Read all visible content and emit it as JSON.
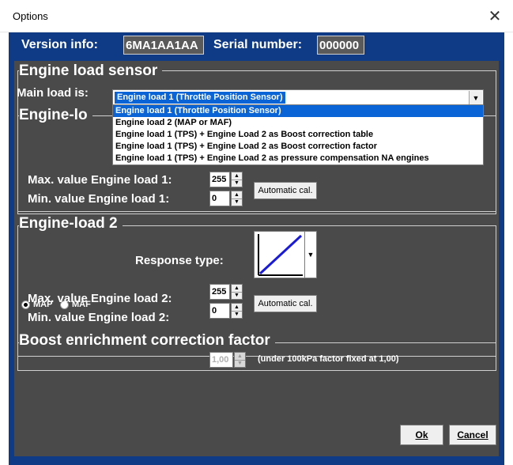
{
  "window": {
    "title": "Options",
    "close_glyph": "✕"
  },
  "version": {
    "label": "Version info:",
    "value": "6MA1AA1AA",
    "serial_label": "Serial number:",
    "serial_value": "000000"
  },
  "engine_load_sensor": {
    "title": "Engine load sensor",
    "main_load_label": "Main load is:",
    "selected": "Engine load 1 (Throttle Position Sensor)",
    "options": [
      "Engine load 1 (Throttle Position Sensor)",
      "Engine load 2 (MAP or MAF)",
      "Engine load 1 (TPS) + Engine Load 2 as Boost correction table",
      "Engine load 1 (TPS) + Engine Load 2 as Boost correction factor",
      "Engine load 1 (TPS) + Engine Load 2 as pressure compensation NA engines"
    ]
  },
  "engine_load_1": {
    "title_visible": "Engine-lo",
    "max_label": "Max. value Engine load 1:",
    "max_value": "255",
    "min_label": "Min.  value Engine load 1:",
    "min_value": "0",
    "auto_cal": "Automatic cal."
  },
  "engine_load_2": {
    "title": "Engine-load 2",
    "radio_map": "MAP",
    "radio_maf": "MAF",
    "selected_radio": "MAP",
    "response_label": "Response type:",
    "response_icon": "linear-response-icon",
    "max_label": "Max. value Engine load 2:",
    "max_value": "255",
    "min_label": "Min.  value Engine load 2:",
    "min_value": "0",
    "auto_cal": "Automatic cal."
  },
  "boost": {
    "title": "Boost enrichment correction factor",
    "value": "1,00",
    "note": "(under 100kPa factor fixed at 1,00)"
  },
  "buttons": {
    "ok": "Ok",
    "cancel": "Cancel"
  },
  "colors": {
    "frame_blue": "#0e3a86",
    "panel_gray": "#4a4a4a",
    "selection_blue": "#0a64d6",
    "response_line": "#1a1adb"
  }
}
